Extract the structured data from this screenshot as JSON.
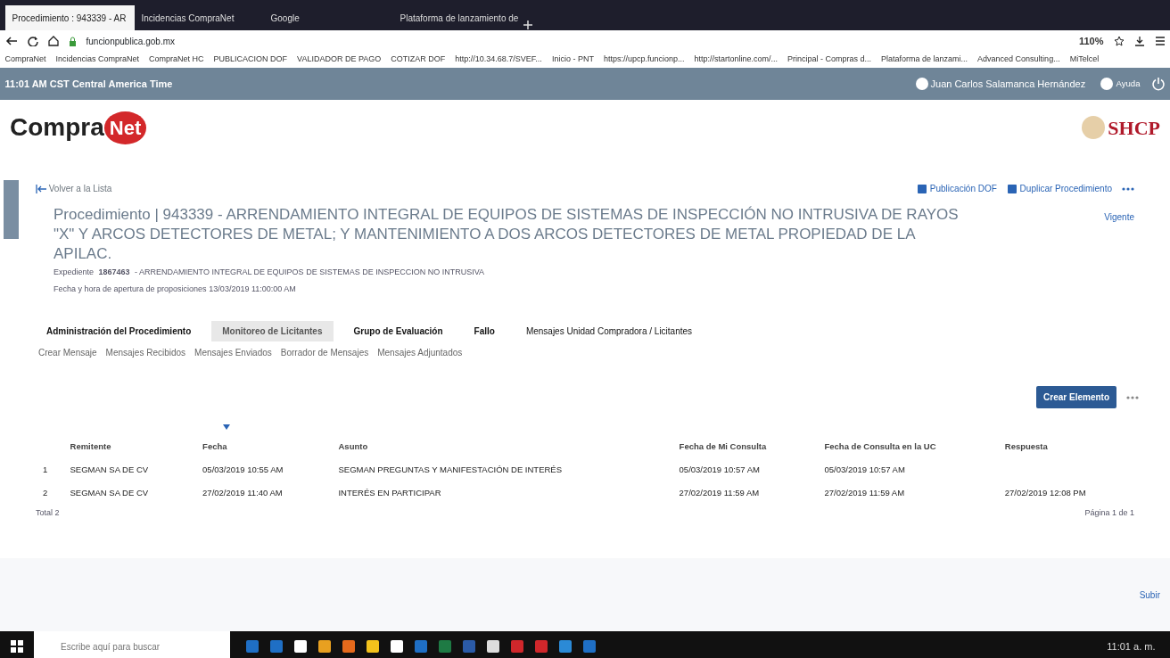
{
  "browser": {
    "tabs": [
      {
        "title": "Procedimiento : 943339 - AR",
        "selected": true
      },
      {
        "title": "Incidencias CompraNet",
        "selected": false
      },
      {
        "title": "Google",
        "selected": false
      },
      {
        "title": "Plataforma de lanzamiento de",
        "selected": false
      }
    ],
    "url_domain": "funcionpublica.gob.mx",
    "zoom": "110%",
    "bookmarks": [
      "CompraNet",
      "Incidencias CompraNet",
      "CompraNet HC",
      "PUBLICACION DOF",
      "VALIDADOR DE PAGO",
      "COTIZAR DOF",
      "http://10.34.68.7/SVEF...",
      "Inicio - PNT",
      "https://upcp.funcionp...",
      "http://startonline.com/...",
      "Principal - Compras d...",
      "Plataforma de lanzami...",
      "Advanced Consulting...",
      "MiTelcel"
    ]
  },
  "header": {
    "time": "11:01 AM CST  Central America Time",
    "user": "Juan Carlos Salamanca Hernández",
    "help": "Ayuda"
  },
  "logo": {
    "left_text": "Compra",
    "circle_text": "Net",
    "right_text": "SHCP"
  },
  "back_link": "Volver a la Lista",
  "actions": [
    "Publicación DOF",
    "Duplicar Procedimiento"
  ],
  "status": "Vigente",
  "procedure": {
    "label": "Procedimiento",
    "separator": "|",
    "title": "943339 - ARRENDAMIENTO INTEGRAL DE EQUIPOS DE SISTEMAS DE INSPECCIÓN NO INTRUSIVA DE RAYOS \"X\" Y ARCOS DETECTORES DE METAL; Y MANTENIMIENTO A DOS ARCOS DETECTORES DE METAL PROPIEDAD DE LA APILAC.",
    "expediente_label": "Expediente",
    "expediente_number": "1867463",
    "expediente_text": "- ARRENDAMIENTO INTEGRAL DE EQUIPOS DE SISTEMAS DE INSPECCION NO INTRUSIVA",
    "opening_label": "Fecha y hora de apertura de proposiciones",
    "opening_value": "13/03/2019 11:00:00 AM"
  },
  "tabs": [
    {
      "label": "Administración del Procedimiento",
      "selected": false
    },
    {
      "label": "Monitoreo de Licitantes",
      "selected": true
    },
    {
      "label": "Grupo de Evaluación",
      "selected": false
    },
    {
      "label": "Fallo",
      "selected": false
    },
    {
      "label": "Mensajes Unidad Compradora / Licitantes",
      "selected": false
    }
  ],
  "subtabs": [
    "Crear Mensaje",
    "Mensajes Recibidos",
    "Mensajes Enviados",
    "Borrador de Mensajes",
    "Mensajes Adjuntados"
  ],
  "create_button": "Crear Elemento",
  "table": {
    "columns": [
      "",
      "Remitente",
      "Fecha",
      "Asunto",
      "Fecha de Mi Consulta",
      "Fecha de Consulta en la UC",
      "Respuesta"
    ],
    "rows": [
      [
        "1",
        "SEGMAN SA DE CV",
        "05/03/2019 10:55 AM",
        "SEGMAN  PREGUNTAS Y MANIFESTACIÓN DE INTERÉS",
        "05/03/2019 10:57 AM",
        "05/03/2019 10:57 AM",
        ""
      ],
      [
        "2",
        "SEGMAN SA DE CV",
        "27/02/2019 11:40 AM",
        "INTERÉS EN PARTICIPAR",
        "27/02/2019 11:59 AM",
        "27/02/2019 11:59 AM",
        "27/02/2019 12:08 PM"
      ]
    ],
    "total": "Total 2",
    "pagination": "Página 1 de 1"
  },
  "footer": {
    "top_link": "Subir"
  },
  "taskbar": {
    "search_placeholder": "Escribe aquí para buscar",
    "clock": "11:01 a. m."
  }
}
